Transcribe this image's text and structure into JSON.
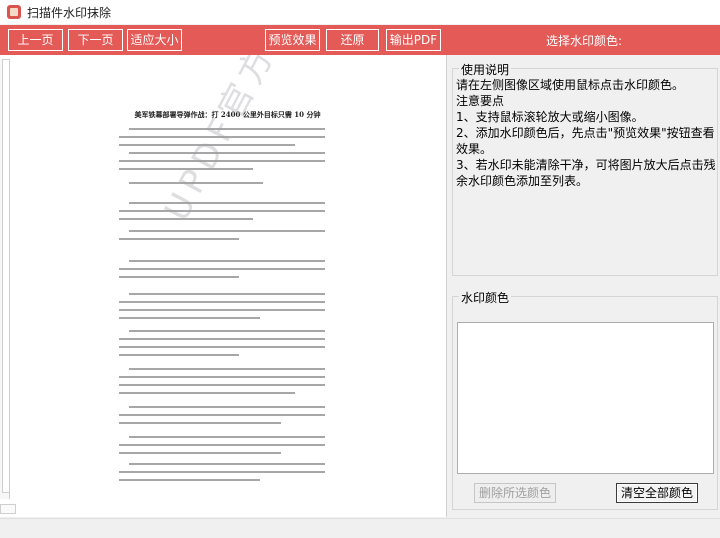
{
  "window": {
    "title": "扫描件水印抹除",
    "icon": "app-logo-icon"
  },
  "toolbar": {
    "buttons": [
      {
        "label": "上一页"
      },
      {
        "label": "下一页"
      },
      {
        "label": "适应大小"
      },
      {
        "label": "预览效果"
      },
      {
        "label": "还原"
      },
      {
        "label": "输出PDF"
      }
    ],
    "select_color_label": "选择水印颜色:"
  },
  "preview": {
    "doc_title": "美军铁幕部署导弹作战：打 2400 公里外目标只需 10 分钟",
    "watermark_text": "UPDF官方水印"
  },
  "instructions": {
    "legend": "使用说明",
    "lines": [
      "请在左侧图像区域使用鼠标点击水印颜色。",
      "注意要点",
      "1、支持鼠标滚轮放大或缩小图像。",
      "2、添加水印颜色后，先点击\"预览效果\"按钮查看效果。",
      "3、若水印未能清除干净，可将图片放大后点击残余水印颜色添加至列表。"
    ]
  },
  "watermark_colors": {
    "legend": "水印颜色",
    "items": [],
    "delete_selected_label": "删除所选颜色",
    "clear_all_label": "清空全部颜色"
  },
  "colors": {
    "accent": "#e35a57",
    "button_border": "#ffffff"
  }
}
